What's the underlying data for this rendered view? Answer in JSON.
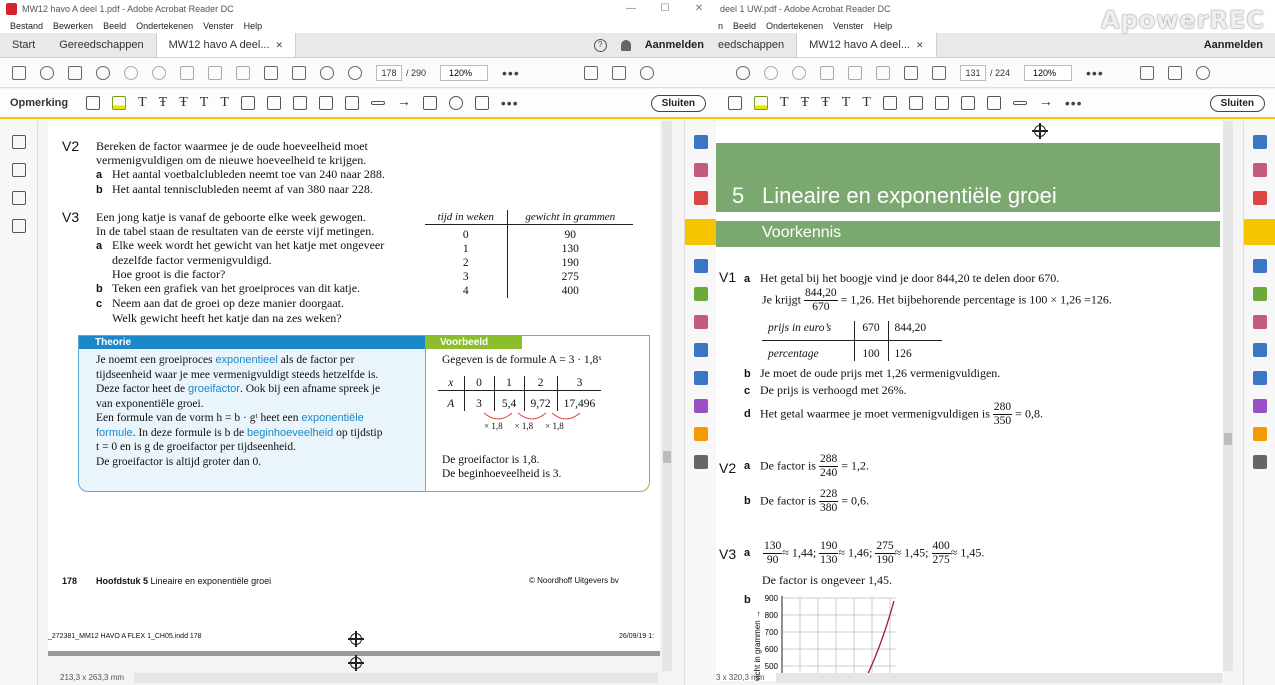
{
  "left_window": {
    "title": "MW12 havo A deel 1.pdf - Adobe Acrobat Reader DC",
    "menu": [
      "Bestand",
      "Bewerken",
      "Beeld",
      "Ondertekenen",
      "Venster",
      "Help"
    ],
    "tabs": [
      "Start",
      "Gereedschappen",
      "MW12 havo A deel..."
    ],
    "signin": "Aanmelden",
    "page_current": "178",
    "page_total": "/ 290",
    "zoom": "120%",
    "comment_label": "Opmerking",
    "close_label": "Sluiten",
    "status_size": "213,3 x 263,3 mm"
  },
  "right_window": {
    "title": "deel 1 UW.pdf - Adobe Acrobat Reader DC",
    "menu": [
      "n",
      "Beeld",
      "Ondertekenen",
      "Venster",
      "Help"
    ],
    "tabs": [
      "eedschappen",
      "MW12 havo A deel..."
    ],
    "signin": "Aanmelden",
    "page_current": "131",
    "page_total": "/ 224",
    "zoom": "120%",
    "close_label": "Sluiten",
    "status_size": "3 x 320,3 mm"
  },
  "watermark": "ApowerREC",
  "left_page": {
    "v2": {
      "num": "V2",
      "line1": "Bereken de factor waarmee je de oude hoeveelheid moet",
      "line2": "vermenigvuldigen om de nieuwe hoeveelheid te krijgen.",
      "a": "Het aantal voetbalclubleden neemt toe van 240 naar 288.",
      "b": "Het aantal tennisclubleden neemt af van 380 naar 228."
    },
    "v3": {
      "num": "V3",
      "line1": "Een jong katje is vanaf de geboorte elke week gewogen.",
      "line2": "In de tabel staan de resultaten van de eerste vijf metingen.",
      "a1": "Elke week wordt het gewicht van het katje met ongeveer",
      "a2": "dezelfde factor vermenigvuldigd.",
      "a3": "Hoe groot is die factor?",
      "b": "Teken een grafiek van het groeiproces van dit katje.",
      "c1": "Neem aan dat de groei op deze manier doorgaat.",
      "c2": "Welk gewicht heeft het katje dan na zes weken?",
      "table_head": [
        "tijd in weken",
        "gewicht in grammen"
      ],
      "table_rows": [
        [
          "0",
          "90"
        ],
        [
          "1",
          "130"
        ],
        [
          "2",
          "190"
        ],
        [
          "3",
          "275"
        ],
        [
          "4",
          "400"
        ]
      ]
    },
    "theorie": {
      "head": "Theorie",
      "l1a": "Je noemt een groeiproces ",
      "l1k": "exponentieel",
      "l1b": " als de factor per",
      "l2": "tijdseenheid waar je mee vermenigvuldigt steeds hetzelfde is.",
      "l3a": "Deze factor heet de ",
      "l3k": "groeifactor",
      "l3b": ". Ook bij een afname spreek je",
      "l4": "van exponentiële groei.",
      "l5a": "Een formule van de vorm h = b · gᵗ heet een ",
      "l5k": "exponentiële",
      "l6k": "formule",
      "l6a": ". In deze formule is b de ",
      "l6k2": "beginhoeveelheid",
      "l6b": " op tijdstip",
      "l7": "t = 0 en is g de groeifactor per tijdseenheid.",
      "l8": "De groeifactor is altijd groter dan 0."
    },
    "voorbeeld": {
      "head": "Voorbeeld",
      "formula": "Gegeven is de formule A = 3 · 1,8ˣ",
      "x_row": [
        "x",
        "0",
        "1",
        "2",
        "3"
      ],
      "a_row": [
        "A",
        "3",
        "5,4",
        "9,72",
        "17,496"
      ],
      "factors": [
        "× 1,8",
        "× 1,8",
        "× 1,8"
      ],
      "r1": "De groeifactor is 1,8.",
      "r2": "De beginhoeveelheid is 3."
    },
    "footer_page": "178",
    "footer_chapter_bold": "Hoofdstuk 5",
    "footer_chapter": " Lineaire en exponentiële groei",
    "footer_publisher": "© Noordhoff Uitgevers bv",
    "slug_left": "_272381_MM12 HAVO A FLEX 1_CH05.indd   178",
    "slug_right": "26/09/19   1:"
  },
  "right_page": {
    "chapter_num": "5",
    "chapter_title": "Lineaire en exponentiële groei",
    "section": "Voorkennis",
    "v1": {
      "num": "V1",
      "a": "Het getal bij het boogje vind je door 844,20 te delen door 670.",
      "je_krijgt": "Je krijgt",
      "f1_num": "844,20",
      "f1_den": "670",
      "a_rest": "= 1,26. Het bijbehorende percentage is 100 × 1,26 =126.",
      "t_head": [
        "prijs in euro’s",
        "670",
        "844,20"
      ],
      "t_row": [
        "percentage",
        "100",
        "126"
      ],
      "b": "Je moet de oude prijs met 1,26 vermenigvuldigen.",
      "c": "De prijs is verhoogd met 26%.",
      "d": "Het getal waarmee je moet vermenigvuldigen is",
      "d_num": "280",
      "d_den": "350",
      "d_rest": "= 0,8."
    },
    "v2": {
      "num": "V2",
      "a": "De factor is",
      "a_num": "288",
      "a_den": "240",
      "a_rest": "= 1,2.",
      "b": "De factor is",
      "b_num": "228",
      "b_den": "380",
      "b_rest": "= 0,6."
    },
    "v3": {
      "num": "V3",
      "fracs": [
        {
          "num": "130",
          "den": "90",
          "rest": "≈ 1,44;"
        },
        {
          "num": "190",
          "den": "130",
          "rest": "≈ 1,46;"
        },
        {
          "num": "275",
          "den": "190",
          "rest": "≈ 1,45;"
        },
        {
          "num": "400",
          "den": "275",
          "rest": "≈ 1,45."
        }
      ],
      "line2": "De factor is ongeveer 1,45.",
      "ylabel": "wicht in grammen →",
      "yticks": [
        "900",
        "800",
        "700",
        "600",
        "500"
      ]
    }
  },
  "colors": {
    "comment_accent": "#f6c300",
    "theorie_blue": "#1a88c9",
    "voorbeeld_green": "#8bbd2c",
    "chapter_green": "#7aa86e"
  }
}
